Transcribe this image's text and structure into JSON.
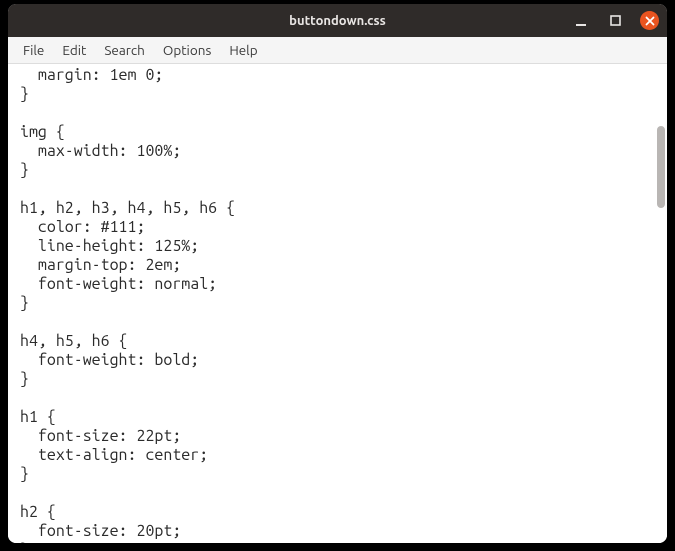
{
  "window": {
    "title": "buttondown.css"
  },
  "menubar": {
    "items": [
      {
        "label": "File"
      },
      {
        "label": "Edit"
      },
      {
        "label": "Search"
      },
      {
        "label": "Options"
      },
      {
        "label": "Help"
      }
    ]
  },
  "editor": {
    "content": "  margin: 1em 0;\n}\n\nimg {\n  max-width: 100%;\n}\n\nh1, h2, h3, h4, h5, h6 {\n  color: #111;\n  line-height: 125%;\n  margin-top: 2em;\n  font-weight: normal;\n}\n\nh4, h5, h6 {\n  font-weight: bold;\n}\n\nh1 {\n  font-size: 22pt;\n  text-align: center;\n}\n\nh2 {\n  font-size: 20pt;\n}"
  }
}
